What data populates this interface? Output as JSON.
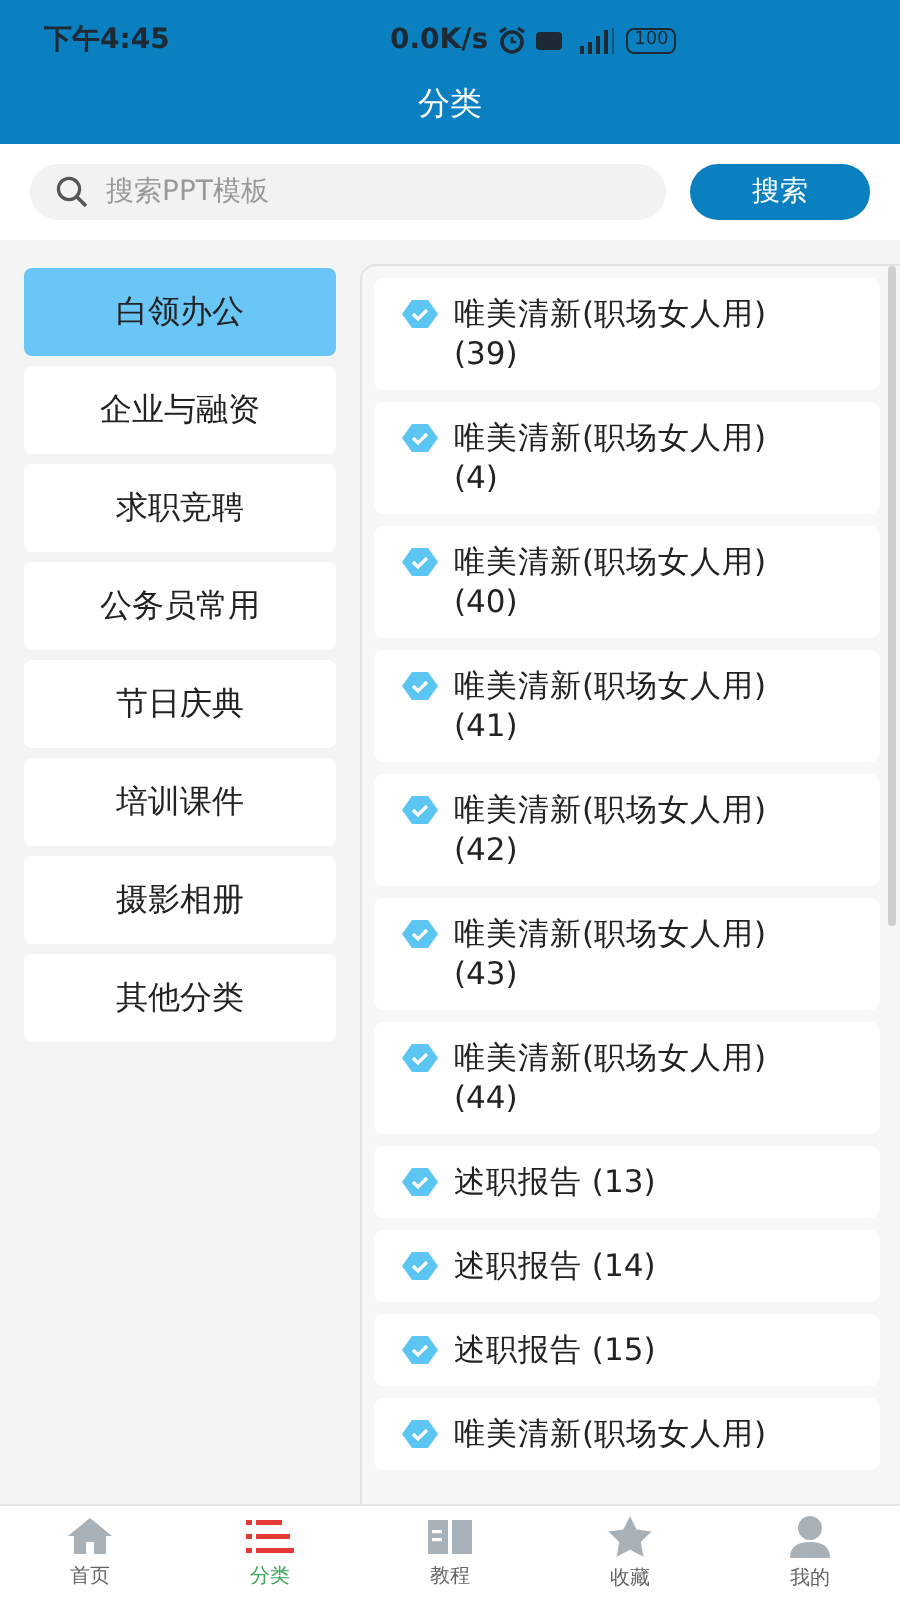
{
  "status_bar": {
    "time": "下午4:45",
    "speed": "0.0K/s",
    "battery": "100"
  },
  "header": {
    "title": "分类"
  },
  "search": {
    "placeholder": "搜索PPT模板",
    "button": "搜索"
  },
  "categories": [
    {
      "label": "白领办公",
      "selected": true
    },
    {
      "label": "企业与融资",
      "selected": false
    },
    {
      "label": "求职竞聘",
      "selected": false
    },
    {
      "label": "公务员常用",
      "selected": false
    },
    {
      "label": "节日庆典",
      "selected": false
    },
    {
      "label": "培训课件",
      "selected": false
    },
    {
      "label": "摄影相册",
      "selected": false
    },
    {
      "label": "其他分类",
      "selected": false
    }
  ],
  "templates": [
    {
      "title": "唯美清新(职场女人用)(39)"
    },
    {
      "title": "唯美清新(职场女人用)(4)"
    },
    {
      "title": "唯美清新(职场女人用)(40)"
    },
    {
      "title": "唯美清新(职场女人用)(41)"
    },
    {
      "title": "唯美清新(职场女人用)(42)"
    },
    {
      "title": "唯美清新(职场女人用)(43)"
    },
    {
      "title": "唯美清新(职场女人用)(44)"
    },
    {
      "title": "述职报告 (13)"
    },
    {
      "title": "述职报告 (14)"
    },
    {
      "title": "述职报告 (15)"
    },
    {
      "title": "唯美清新(职场女人用)"
    }
  ],
  "tab_bar": [
    {
      "label": "首页",
      "kind": "home",
      "selected": false
    },
    {
      "label": "分类",
      "kind": "list",
      "selected": true
    },
    {
      "label": "教程",
      "kind": "book",
      "selected": false
    },
    {
      "label": "收藏",
      "kind": "star",
      "selected": false
    },
    {
      "label": "我的",
      "kind": "person",
      "selected": false
    }
  ]
}
